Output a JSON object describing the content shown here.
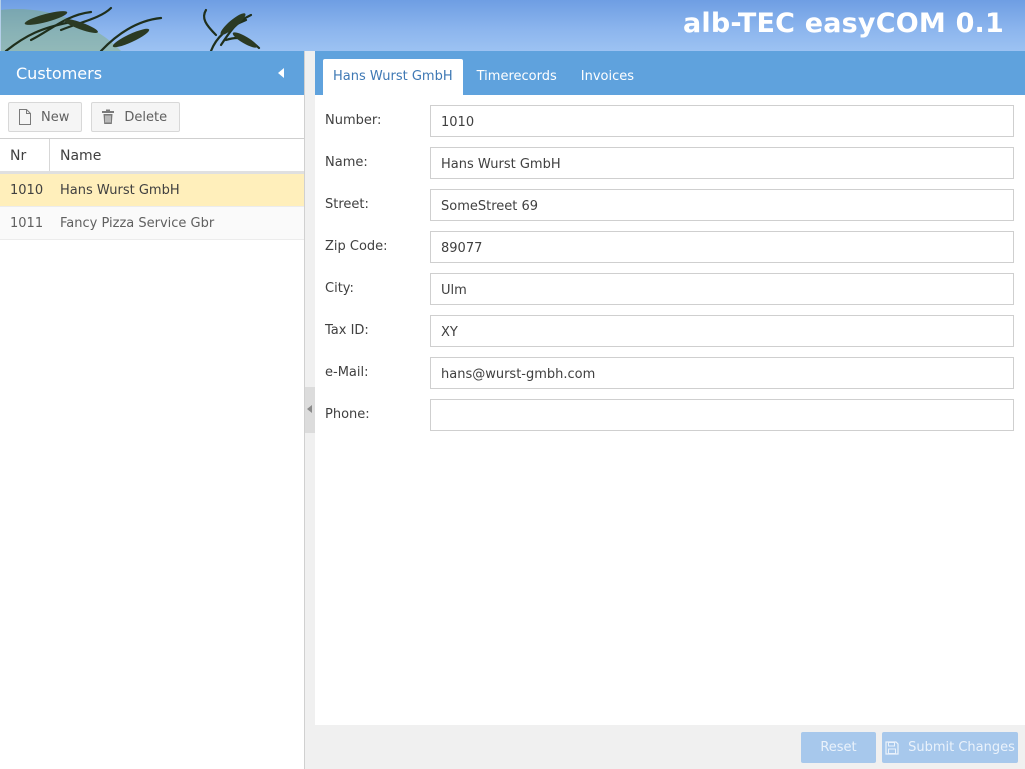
{
  "app": {
    "title": "alb-TEC easyCOM 0.1"
  },
  "customers_panel": {
    "title": "Customers",
    "toolbar": {
      "new_label": "New",
      "delete_label": "Delete"
    },
    "columns": {
      "nr": "Nr",
      "name": "Name"
    },
    "rows": [
      {
        "nr": "1010",
        "name": "Hans Wurst GmbH",
        "selected": true
      },
      {
        "nr": "1011",
        "name": "Fancy Pizza Service Gbr",
        "selected": false
      }
    ]
  },
  "tabs": [
    {
      "label": "Hans Wurst GmbH",
      "active": true
    },
    {
      "label": "Timerecords",
      "active": false
    },
    {
      "label": "Invoices",
      "active": false
    }
  ],
  "form": {
    "fields": [
      {
        "label": "Number:",
        "value": "1010"
      },
      {
        "label": "Name:",
        "value": "Hans Wurst GmbH"
      },
      {
        "label": "Street:",
        "value": "SomeStreet 69"
      },
      {
        "label": "Zip Code:",
        "value": "89077"
      },
      {
        "label": "City:",
        "value": "Ulm"
      },
      {
        "label": "Tax ID:",
        "value": "XY"
      },
      {
        "label": "e-Mail:",
        "value": "hans@wurst-gmbh.com"
      },
      {
        "label": "Phone:",
        "value": ""
      }
    ],
    "reset_label": "Reset",
    "submit_label": "Submit Changes"
  },
  "colors": {
    "accent": "#5fa2dd",
    "selection": "#ffefbb",
    "disabled_button": "#a7c8ec"
  }
}
